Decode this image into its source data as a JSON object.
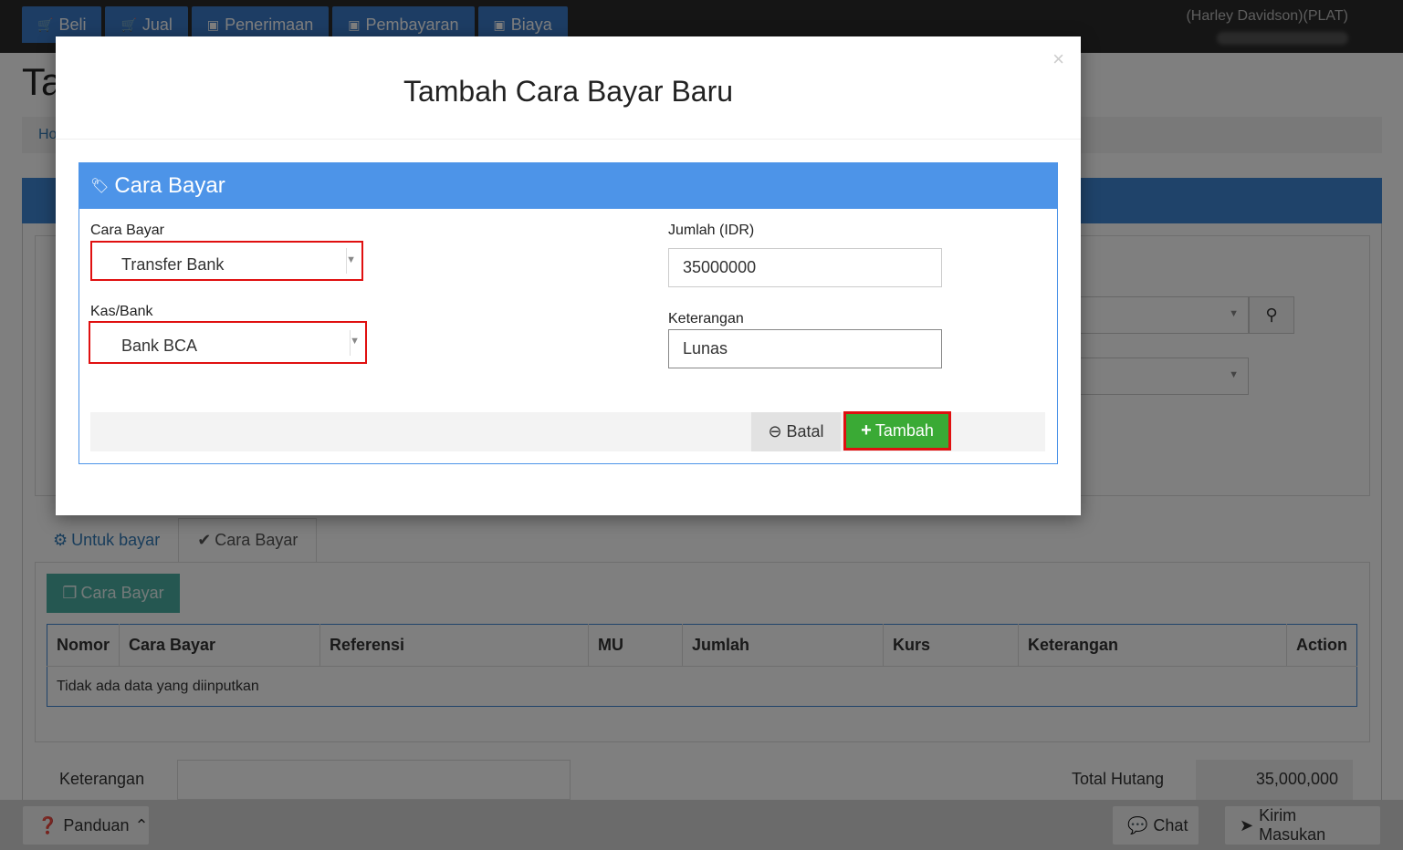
{
  "topnav": [
    {
      "label": "Beli",
      "icon": "cart-icon"
    },
    {
      "label": "Jual",
      "icon": "cart-icon"
    },
    {
      "label": "Penerimaan",
      "icon": "money-icon"
    },
    {
      "label": "Pembayaran",
      "icon": "money-icon"
    },
    {
      "label": "Biaya",
      "icon": "money-icon"
    }
  ],
  "company": "(Harley Davidson)(PLAT)",
  "page": {
    "title": "Ta",
    "breadcrumb": "Ho"
  },
  "tabs": {
    "untuk_bayar": "Untuk bayar",
    "cara_bayar": "Cara Bayar"
  },
  "cara_bayar_button": "Cara Bayar",
  "table": {
    "headers": [
      "Nomor",
      "Cara Bayar",
      "Referensi",
      "MU",
      "Jumlah",
      "Kurs",
      "Keterangan",
      "Action"
    ],
    "empty_text": "Tidak ada data yang diinputkan"
  },
  "summary": {
    "keterangan_label": "Keterangan",
    "total_label": "Total Hutang",
    "total_value": "35,000,000"
  },
  "footer": {
    "panduan": "Panduan",
    "chat": "Chat",
    "kirim": "Kirim Masukan"
  },
  "modal": {
    "title": "Tambah Cara Bayar Baru",
    "close": "×",
    "panel_title": "Cara Bayar",
    "cara_bayar_label": "Cara Bayar",
    "cara_bayar_value": "Transfer Bank",
    "kas_bank_label": "Kas/Bank",
    "kas_bank_value": "Bank BCA",
    "jumlah_label": "Jumlah (IDR)",
    "jumlah_value": "35000000",
    "keterangan_label": "Keterangan",
    "keterangan_value": "Lunas",
    "batal": "Batal",
    "tambah": "Tambah"
  },
  "colors": {
    "primary_blue": "#3e86d4",
    "highlight_red": "#e01010",
    "success_green": "#3aaa35",
    "teal": "#4aaea3"
  }
}
